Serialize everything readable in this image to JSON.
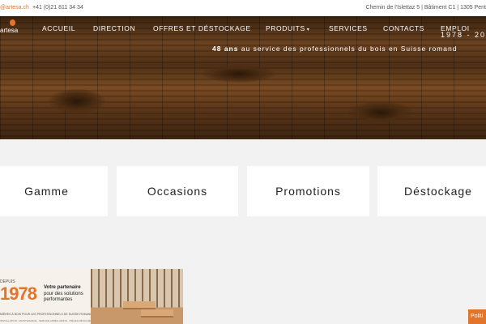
{
  "topbar": {
    "email": "@artesa.ch",
    "phone": "+41 (0)21 811 34 34",
    "address": "Chemin de l'Islettaz 5 | Bâtiment C1 | 1305 Pent"
  },
  "brand": {
    "logo_text": "artesa"
  },
  "nav": {
    "items": [
      "ACCUEIL",
      "DIRECTION",
      "OFFRES ET DÉSTOCKAGE",
      "PRODUITS",
      "SERVICES",
      "CONTACTS",
      "EMPLOI"
    ],
    "dropdown_caret": "▾"
  },
  "hero": {
    "years": "1978 - 20",
    "tagline_bold": "48 ans",
    "tagline_rest": " au service des professionnels du bois en Suisse romand"
  },
  "categories": [
    "Gamme",
    "Occasions",
    "Promotions",
    "Déstockage"
  ],
  "promo": {
    "since": "DEPUIS",
    "year": "1978",
    "headline": "Votre partenaire",
    "subheadline": "pour des solutions performantes",
    "tagline": "MIÈRES À BOIS POUR LES PROFESSIONNELS DE SUISSE ROMANDE",
    "features": "INSTALLATION · MAINTENANCE · SERVICE APRÈS-VENTE · PIÈCES DÉTACHÉES"
  },
  "policy_button": "Politi",
  "colors": {
    "accent": "#e0752b",
    "background": "#f2f2f2",
    "card": "#ffffff"
  }
}
